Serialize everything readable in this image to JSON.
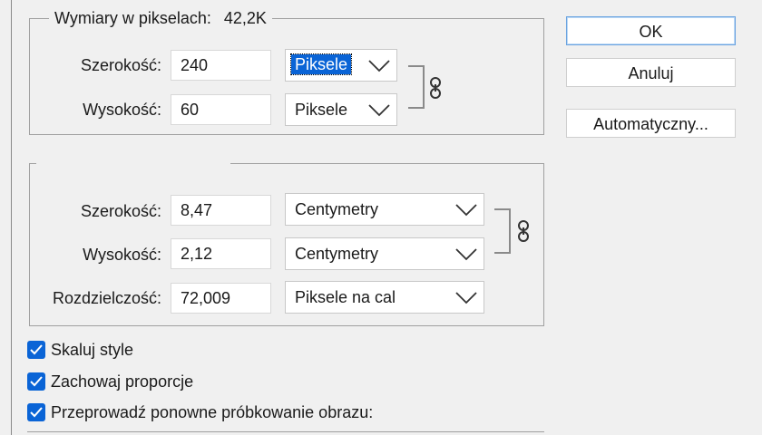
{
  "pixel_dimensions": {
    "legend": "Wymiary w pikselach:",
    "size": "42,2K",
    "width_label": "Szerokość:",
    "width_value": "240",
    "width_unit": "Piksele",
    "height_label": "Wysokość:",
    "height_value": "60",
    "height_unit": "Piksele"
  },
  "document_size": {
    "width_label": "Szerokość:",
    "width_value": "8,47",
    "width_unit": "Centymetry",
    "height_label": "Wysokość:",
    "height_value": "2,12",
    "height_unit": "Centymetry",
    "resolution_label": "Rozdzielczość:",
    "resolution_value": "72,009",
    "resolution_unit": "Piksele na cal"
  },
  "buttons": {
    "ok": "OK",
    "cancel": "Anuluj",
    "auto": "Automatyczny..."
  },
  "options": {
    "scale_styles": "Skaluj style",
    "constrain": "Zachowaj proporcje",
    "resample": "Przeprowadź ponowne próbkowanie obrazu:"
  },
  "colors": {
    "accent": "#0a64d6",
    "background": "#f0f0f0"
  }
}
